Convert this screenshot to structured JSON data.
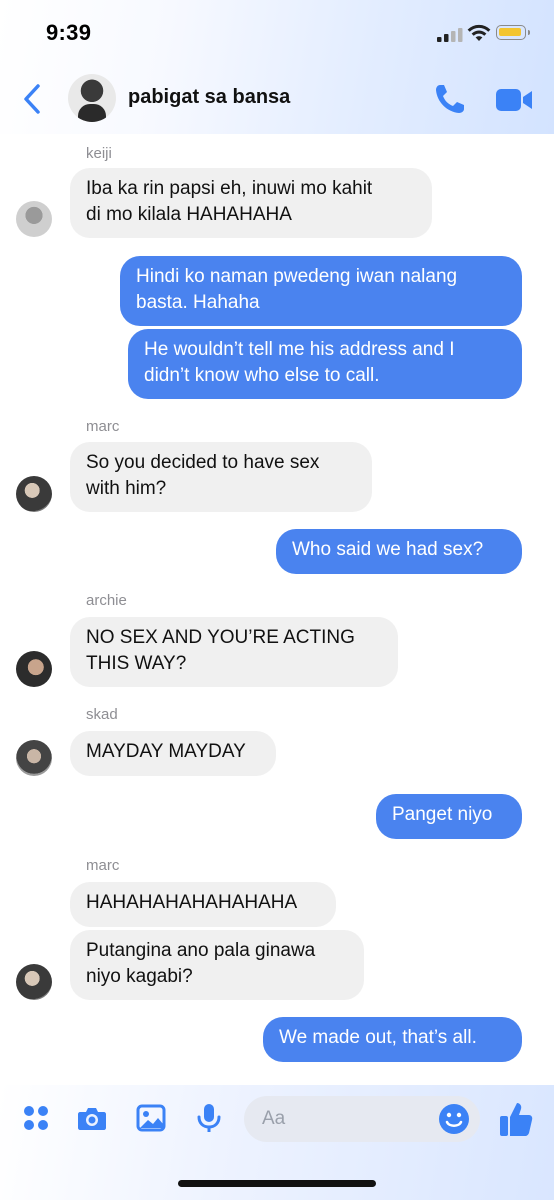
{
  "status_bar": {
    "time": "9:39"
  },
  "header": {
    "title": "pabigat sa bansa"
  },
  "messages": [
    {
      "sender": "keiji",
      "text": "Iba ka rin papsi eh, inuwi mo kahit\ndi mo kilala HAHAHAHA"
    },
    {
      "text": "Hindi ko naman pwedeng iwan nalang\nbasta. Hahaha"
    },
    {
      "text": "He wouldn’t tell me his address and I\ndidn’t know who else to call."
    },
    {
      "sender": "marc",
      "text": "So you decided to have sex\nwith him?"
    },
    {
      "text": "Who said we had sex?"
    },
    {
      "sender": "archie",
      "text": "NO SEX AND YOU’RE ACTING\nTHIS WAY?"
    },
    {
      "sender": "skad",
      "text": "MAYDAY MAYDAY"
    },
    {
      "text": "Panget niyo"
    },
    {
      "sender": "marc",
      "text": "HAHAHAHAHAHAHAHA"
    },
    {
      "text": "Putangina ano pala ginawa\nniyo kagabi?"
    },
    {
      "text": "We made out, that’s all."
    }
  ],
  "composer": {
    "placeholder": "Aa"
  },
  "colors": {
    "accent": "#4a83ef",
    "incoming_bubble": "#f0f0f0",
    "outgoing_bubble": "#4a83ef"
  },
  "icons": [
    "back-icon",
    "phone-icon",
    "video-icon",
    "apps-icon",
    "camera-icon",
    "image-icon",
    "microphone-icon",
    "emoji-icon",
    "thumbs-up-icon"
  ]
}
